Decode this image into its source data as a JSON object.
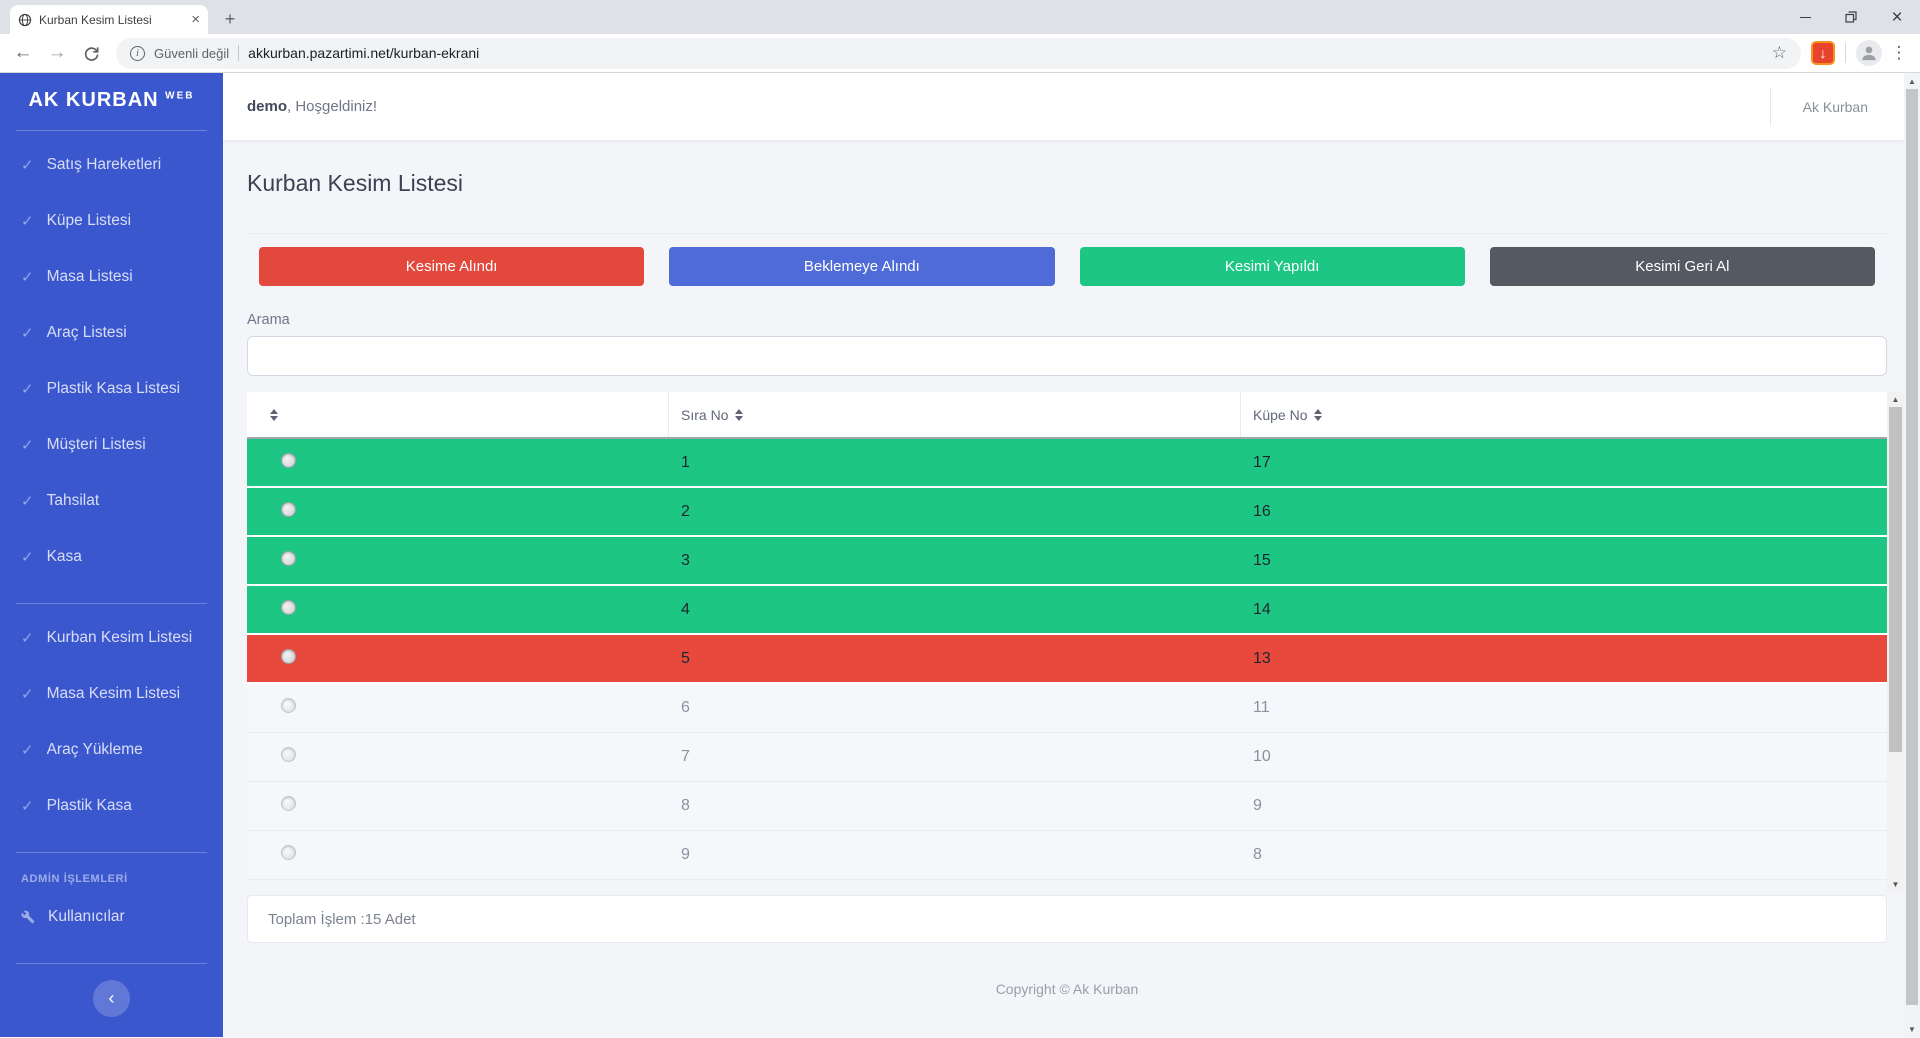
{
  "browser": {
    "tab_title": "Kurban Kesim Listesi",
    "security_label": "Güvenli değil",
    "url": "akkurban.pazartimi.net/kurban-ekrani"
  },
  "sidebar": {
    "brand": "AK KURBAN",
    "brand_sup": "WEB",
    "items_main": [
      "Satış Hareketleri",
      "Küpe Listesi",
      "Masa Listesi",
      "Araç Listesi",
      "Plastik Kasa Listesi",
      "Müşteri Listesi",
      "Tahsilat",
      "Kasa"
    ],
    "items_kesim": [
      "Kurban Kesim Listesi",
      "Masa Kesim Listesi",
      "Araç Yükleme",
      "Plastik Kasa"
    ],
    "admin_label": "ADMİN İŞLEMLERİ",
    "admin_item": "Kullanıcılar"
  },
  "header": {
    "username": "demo",
    "welcome_suffix": ", Hoşgeldiniz!",
    "account": "Ak Kurban"
  },
  "page": {
    "title": "Kurban Kesim Listesi"
  },
  "actions": {
    "kesime_alindi": "Kesime Alındı",
    "beklemeye_alindi": "Beklemeye Alındı",
    "kesimi_yapildi": "Kesimi Yapıldı",
    "kesimi_geri_al": "Kesimi Geri Al"
  },
  "search": {
    "label": "Arama",
    "value": ""
  },
  "table": {
    "columns": {
      "sira": "Sıra No",
      "kupe": "Küpe No"
    },
    "rows": [
      {
        "sira": "1",
        "kupe": "17",
        "status": "green"
      },
      {
        "sira": "2",
        "kupe": "16",
        "status": "green"
      },
      {
        "sira": "3",
        "kupe": "15",
        "status": "green"
      },
      {
        "sira": "4",
        "kupe": "14",
        "status": "green"
      },
      {
        "sira": "5",
        "kupe": "13",
        "status": "red"
      },
      {
        "sira": "6",
        "kupe": "11",
        "status": "plain"
      },
      {
        "sira": "7",
        "kupe": "10",
        "status": "plain"
      },
      {
        "sira": "8",
        "kupe": "9",
        "status": "plain"
      },
      {
        "sira": "9",
        "kupe": "8",
        "status": "plain"
      }
    ],
    "summary": "Toplam İşlem :15 Adet"
  },
  "footer": {
    "copyright": "Copyright © Ak Kurban"
  },
  "colors": {
    "sidebar": "#3b57ce",
    "danger": "#e3483c",
    "primary": "#4e6bd8",
    "success": "#1dc783",
    "dark": "#555962",
    "row_success": "#1dc783",
    "row_danger": "#e74a3c"
  }
}
